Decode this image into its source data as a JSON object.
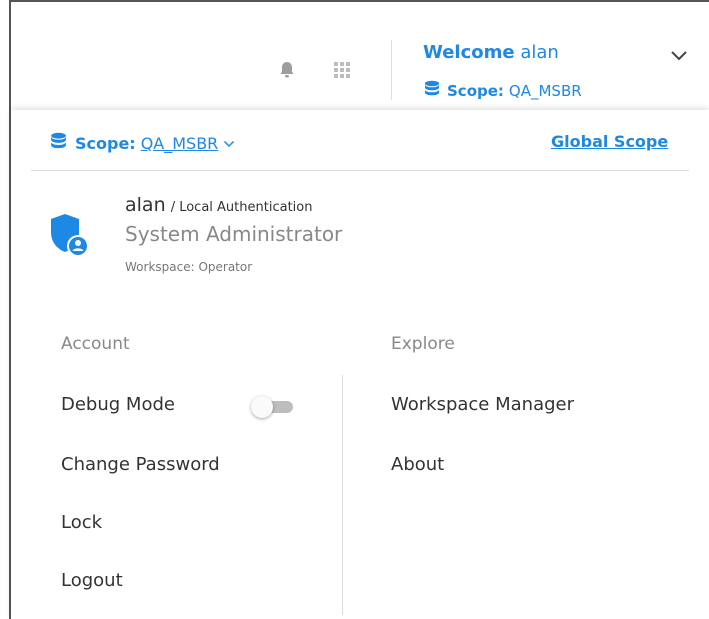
{
  "header": {
    "welcome_word": "Welcome",
    "username": "alan",
    "scope_label": "Scope:",
    "scope_value": "QA_MSBR",
    "icons": {
      "notifications": "bell-icon",
      "apps": "apps-grid-icon",
      "menu": "chevron-down-icon",
      "scope": "database-icon"
    }
  },
  "panel": {
    "scope_label": "Scope:",
    "scope_value": "QA_MSBR",
    "global_scope": "Global Scope",
    "user": {
      "name": "alan",
      "auth": "/ Local Authentication",
      "role": "System Administrator",
      "workspace": "Workspace: Operator",
      "avatar_icon": "admin-shield-icon"
    },
    "account": {
      "heading": "Account",
      "debug_mode": "Debug Mode",
      "debug_enabled": false,
      "change_password": "Change Password",
      "lock": "Lock",
      "logout": "Logout"
    },
    "explore": {
      "heading": "Explore",
      "workspace_manager": "Workspace Manager",
      "about": "About"
    }
  },
  "colors": {
    "accent": "#1e88e5",
    "text": "#333333",
    "muted": "#888888",
    "divider": "#dddddd"
  }
}
